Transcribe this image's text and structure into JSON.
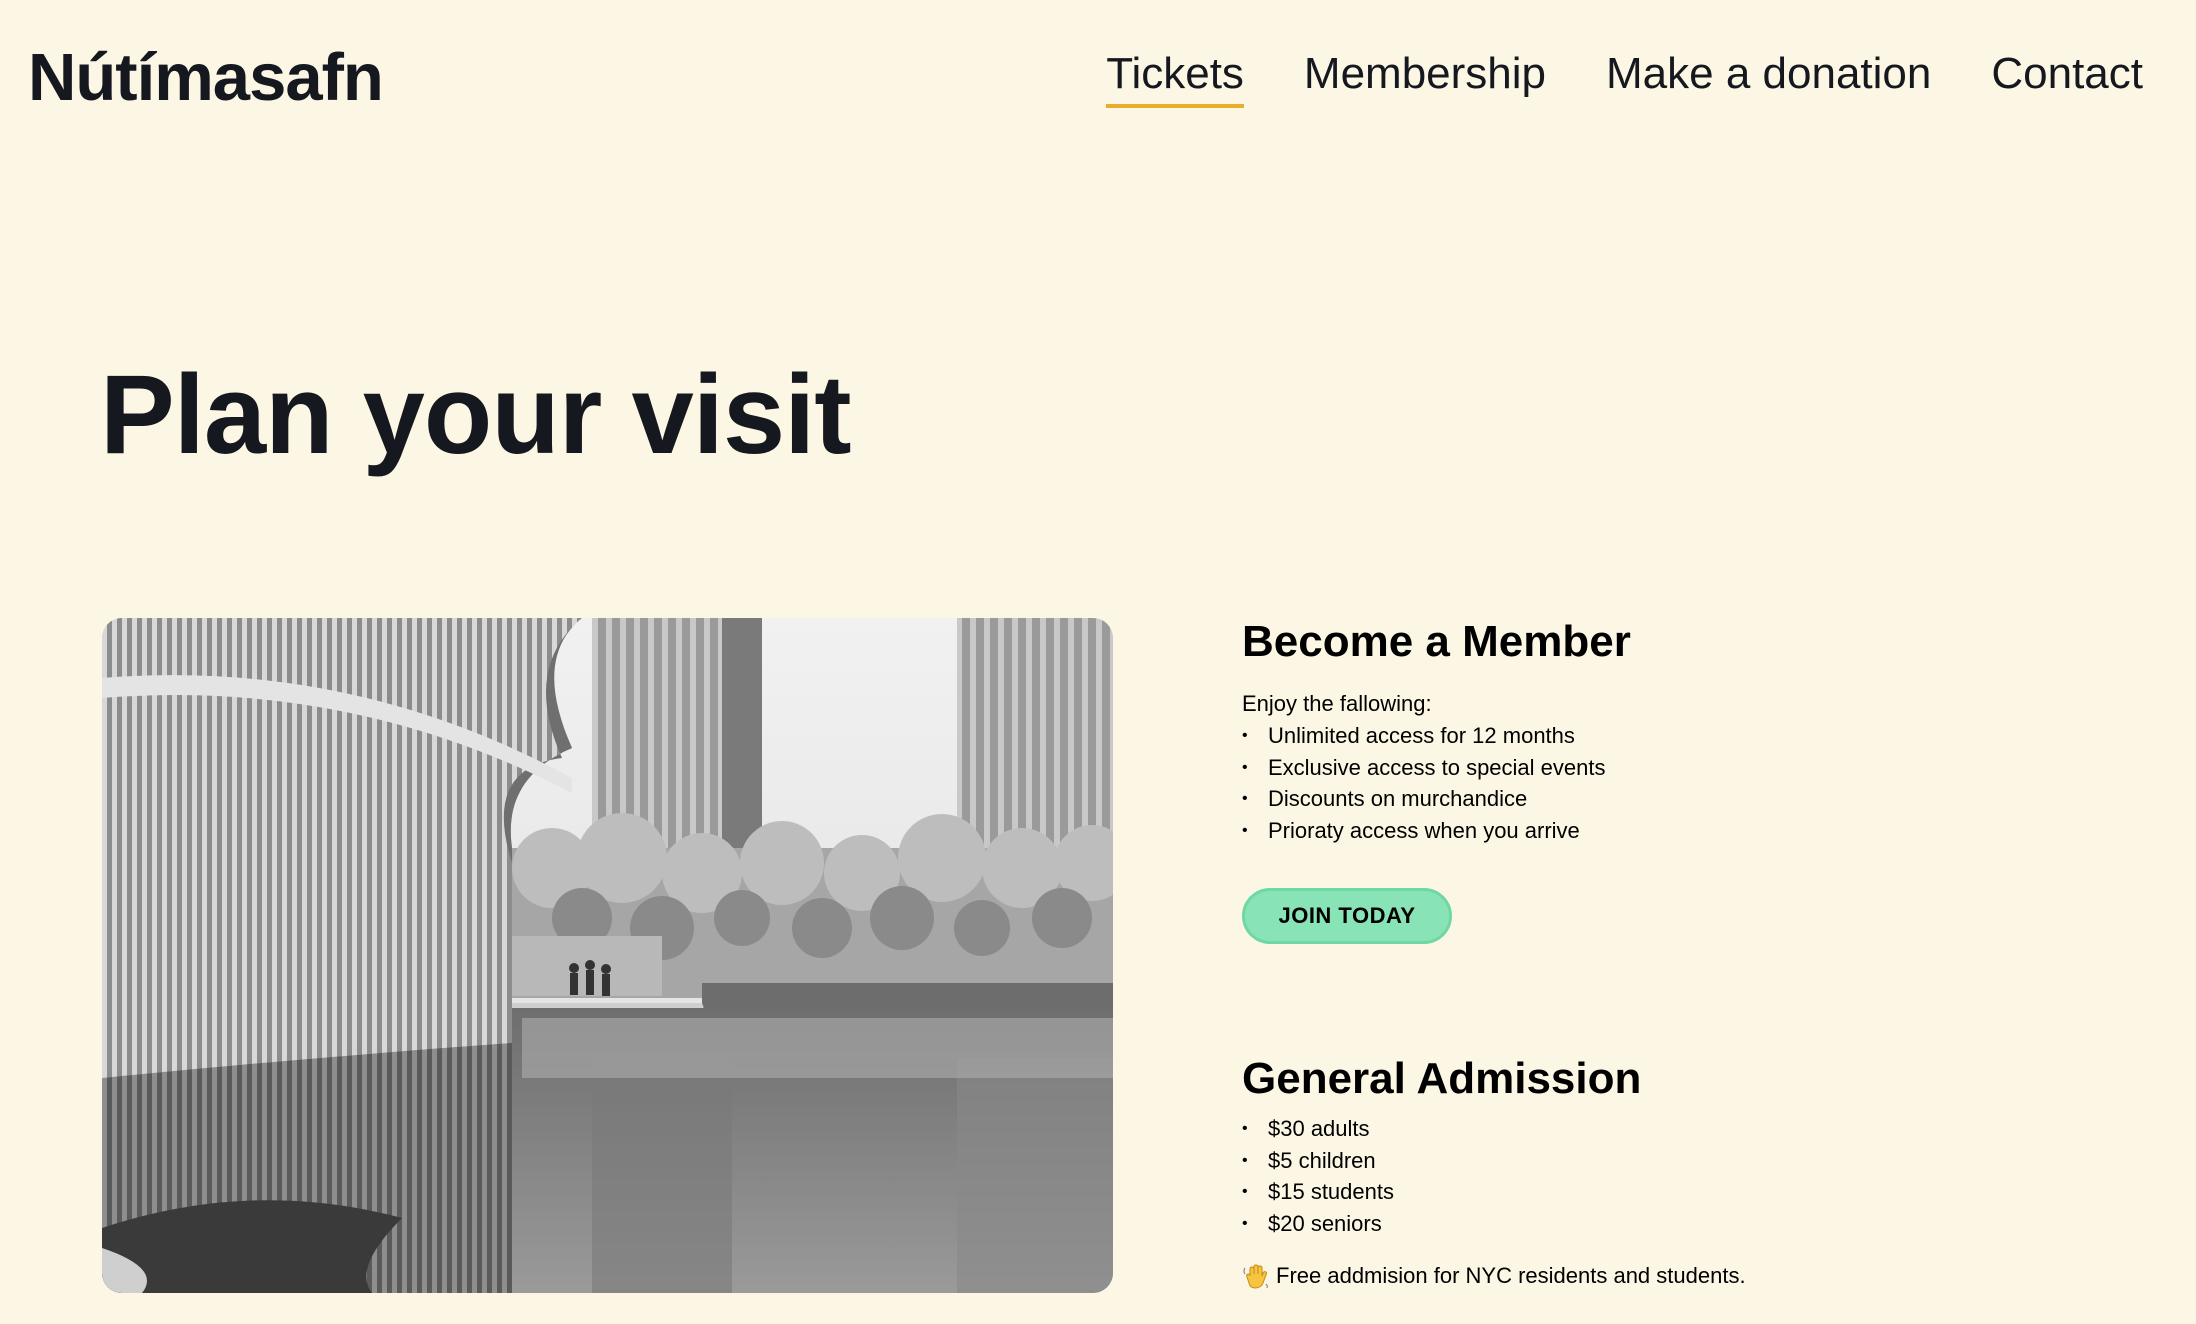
{
  "header": {
    "logo": "Nútímasafn",
    "nav": [
      {
        "label": "Tickets",
        "active": true
      },
      {
        "label": "Membership",
        "active": false
      },
      {
        "label": "Make a donation",
        "active": false
      },
      {
        "label": "Contact",
        "active": false
      }
    ]
  },
  "main": {
    "title": "Plan your visit",
    "photo": {
      "icon": "museum-building-photo"
    },
    "member": {
      "title": "Become a Member",
      "intro": "Enjoy the fallowing:",
      "benefits": [
        "Unlimited access for 12 months",
        "Exclusive access to special events",
        "Discounts on murchandice",
        "Prioraty access when you arrive"
      ],
      "button_label": "JOIN TODAY"
    },
    "admission": {
      "title": "General Admission",
      "prices": [
        "$30 adults",
        "$5 children",
        "$15 students",
        "$20 seniors"
      ],
      "note": "Free addmision for NYC residents and students.",
      "note_icon": "waving-hand-icon"
    }
  },
  "colors": {
    "background": "#fcf6e4",
    "accent_underline": "#e8ad2c",
    "button": "#88e3b6",
    "text": "#15181f"
  }
}
